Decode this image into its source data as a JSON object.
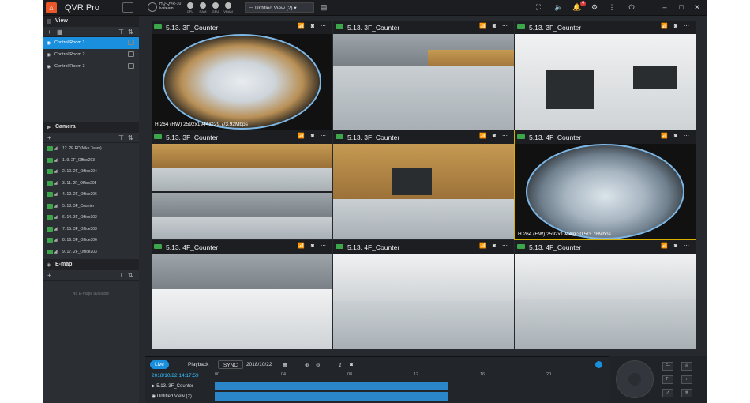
{
  "app": {
    "title": "QVR Pro",
    "nas_name": "HQ-QVR-10",
    "nas_user": "ivateam",
    "stats": [
      "CPU",
      "RAM",
      "GPU",
      "VRAM"
    ],
    "current_view": "Untitled View (2)",
    "alert_count": "4"
  },
  "sidebar": {
    "view": {
      "title": "View",
      "items": [
        "Control Room 1",
        "Control Room 2",
        "Control Room 3"
      ]
    },
    "camera": {
      "title": "Camera",
      "items": [
        "12. 2F RD(Nike Team)",
        "1. 9. 2F_Office203",
        "2. 10. 2F_Office204",
        "3. 11. 2F_Office205",
        "4. 12. 2F_Office206",
        "5. 13. 3F_Counter",
        "6. 14. 3F_Office302",
        "7. 15. 3F_Office303",
        "8. 16. 3F_Office306",
        "9. 17. 2F_Office203"
      ]
    },
    "emap": {
      "title": "E-map",
      "empty_text": "No E-maps available"
    }
  },
  "grid": [
    {
      "title": "5.13. 3F_Counter",
      "info": "H.264 (HW) 2592x1944@29.7/3.92Mbps"
    },
    {
      "title": "5.13. 3F_Counter",
      "info": ""
    },
    {
      "title": "5.13. 3F_Counter",
      "info": ""
    },
    {
      "title": "5.13. 3F_Counter",
      "info": ""
    },
    {
      "title": "5.13. 3F_Counter",
      "info": ""
    },
    {
      "title": "5.13. 4F_Counter",
      "info": "H.264 (HW) 2592x1944@30.5/3.78Mbps"
    },
    {
      "title": "5.13. 4F_Counter",
      "info": ""
    },
    {
      "title": "5.13. 4F_Counter",
      "info": ""
    },
    {
      "title": "5.13. 4F_Counter",
      "info": ""
    }
  ],
  "timeline": {
    "live_label": "Live",
    "playback_label": "Playback",
    "sync_label": "SYNC",
    "date": "2018/10/22",
    "timestamp": "2018/10/22 14:17:59",
    "ticks": [
      "00",
      "04",
      "08",
      "12",
      "16",
      "20"
    ],
    "tracks": [
      "5.13. 3F_Counter",
      "Untitled View (2)"
    ]
  }
}
